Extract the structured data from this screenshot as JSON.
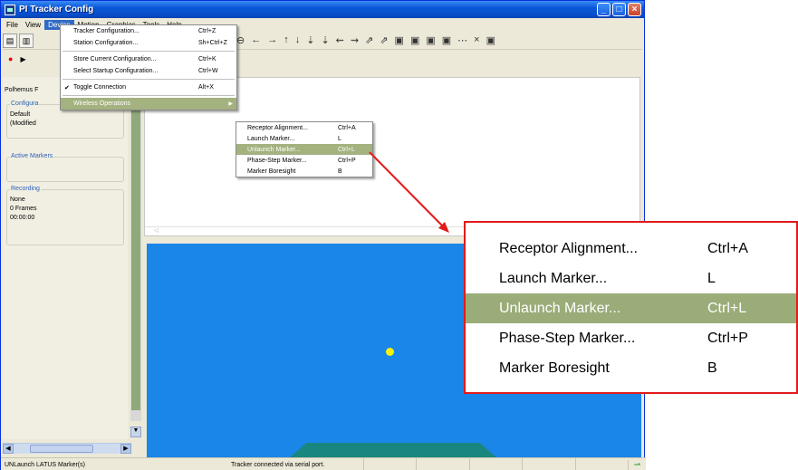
{
  "window": {
    "title": "PI Tracker Config",
    "controls": {
      "minimize": "_",
      "maximize": "□",
      "close": "×"
    }
  },
  "menubar": [
    "File",
    "View",
    "Device",
    "Motion",
    "Graphics",
    "Tools",
    "Help"
  ],
  "toolbar": {
    "toolbar_glyphs": [
      "⊖",
      "←",
      "→",
      "↑",
      "↓",
      "⇣",
      "⇣",
      "⇜",
      "⇝",
      "⇗",
      "⇗",
      "▣",
      "▣",
      "▣",
      "▣",
      "⋯",
      "×",
      "▣"
    ]
  },
  "left_panel": {
    "title": "Polhemus F",
    "configuration": {
      "label": "Configura",
      "line1": "Default",
      "line2": "(Modified"
    },
    "active_markers": {
      "label": "Active Markers"
    },
    "recording": {
      "label": "Recording",
      "line1": "None",
      "line2": "0 Frames",
      "line3": "00:00:00"
    }
  },
  "device_menu": {
    "items": [
      {
        "label": "Tracker Configuration...",
        "shortcut": "Ctrl+Z"
      },
      {
        "label": "Station Configuration...",
        "shortcut": "Sh+Ctrl+Z"
      },
      {
        "label": "Store Current Configuration...",
        "shortcut": "Ctrl+K"
      },
      {
        "label": "Select Startup Configuration...",
        "shortcut": "Ctrl+W"
      },
      {
        "label": "Toggle Connection",
        "shortcut": "Alt+X",
        "checked": true
      },
      {
        "label": "Wireless Operations",
        "shortcut": "",
        "submenu": true
      }
    ]
  },
  "wireless_menu": {
    "items": [
      {
        "label": "Receptor Alignment...",
        "shortcut": "Ctrl+A"
      },
      {
        "label": "Launch Marker...",
        "shortcut": "L"
      },
      {
        "label": "Unlaunch Marker...",
        "shortcut": "Ctrl+L"
      },
      {
        "label": "Phase-Step Marker...",
        "shortcut": "Ctrl+P"
      },
      {
        "label": "Marker Boresight",
        "shortcut": "B"
      }
    ],
    "highlighted_index": 2
  },
  "status_bar": {
    "left": "UNLaunch LATUS Marker(s)",
    "center": "Tracker connected via serial port."
  },
  "colors": {
    "viewport_blue": "#1a86e8",
    "marker_yellow": "#f2f20c",
    "highlight": "#a3b27f",
    "callout_red": "#e21b1b"
  }
}
